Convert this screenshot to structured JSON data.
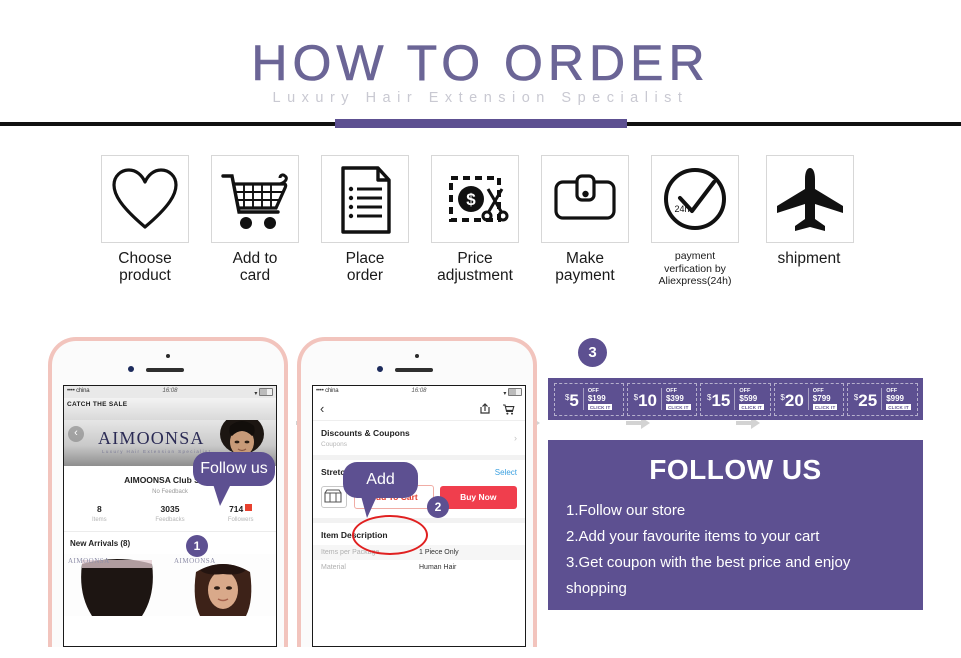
{
  "header": {
    "title": "HOW TO ORDER",
    "subtitle": "Luxury Hair Extension Specialist",
    "accent_color": "#5d5091"
  },
  "steps": [
    {
      "icon": "heart-icon",
      "label_line1": "Choose",
      "label_line2": "product"
    },
    {
      "icon": "shopping-cart-icon",
      "label_line1": "Add to",
      "label_line2": "card"
    },
    {
      "icon": "document-icon",
      "label_line1": "Place",
      "label_line2": "order"
    },
    {
      "icon": "price-scissors-icon",
      "label_line1": "Price",
      "label_line2": "adjustment"
    },
    {
      "icon": "wallet-icon",
      "label_line1": "Make",
      "label_line2": "payment"
    },
    {
      "icon": "clock-check-icon",
      "label_line1": "payment",
      "label_line2": "verfication by",
      "label_line3": "Aliexpress(24h)",
      "icon_text": "24h"
    },
    {
      "icon": "airplane-icon",
      "label_line1": "shipment",
      "label_line2": ""
    }
  ],
  "phone1": {
    "status": {
      "left": "•••• china",
      "center": "16:08",
      "wifi": "wifi-icon"
    },
    "sale_banner": "CATCH THE SALE",
    "logo": "AIMOONSA",
    "logo_sub": "Luxury Hair Extension Specialist",
    "store_name": "AIMOONSA Club Store",
    "feedback": "No Feedback",
    "stats": [
      {
        "value": "8",
        "label": "Items"
      },
      {
        "value": "3035",
        "label": "Feedbacks"
      },
      {
        "value": "714",
        "label": "Followers"
      }
    ],
    "new_arrivals": "New Arrivals (8)",
    "watermark": "AIMOONSA",
    "callout": "Follow us",
    "badge": "1"
  },
  "phone2": {
    "status": {
      "left": "•••• china",
      "center": "16:08"
    },
    "nav": {
      "back": "back-chevron-icon",
      "share": "share-icon",
      "cart": "cart-icon"
    },
    "discounts_title": "Discounts & Coupons",
    "discounts_sub": "Coupons",
    "stretched_title": "Stretched Length",
    "select_label": "Select",
    "add_to_cart": "Add To Cart",
    "buy_now": "Buy Now",
    "item_description": "Item Description",
    "attributes": [
      {
        "key": "Items per Package",
        "value": "1 Piece Only"
      },
      {
        "key": "Material",
        "value": "Human Hair"
      }
    ],
    "callout": "Add",
    "badge": "2"
  },
  "right": {
    "badge": "3",
    "coupons": [
      {
        "currency": "$",
        "amount": "5",
        "off": "OFF",
        "min": "$199",
        "click": "CLICK IT"
      },
      {
        "currency": "$",
        "amount": "10",
        "off": "OFF",
        "min": "$399",
        "click": "CLICK IT"
      },
      {
        "currency": "$",
        "amount": "15",
        "off": "OFF",
        "min": "$599",
        "click": "CLICK IT"
      },
      {
        "currency": "$",
        "amount": "20",
        "off": "OFF",
        "min": "$799",
        "click": "CLICK IT"
      },
      {
        "currency": "$",
        "amount": "25",
        "off": "OFF",
        "min": "$999",
        "click": "CLICK IT"
      }
    ],
    "follow_title": "FOLLOW US",
    "follow_steps": [
      "1.Follow our store",
      "2.Add your favourite items to your cart",
      "3.Get coupon with the best price and enjoy shopping"
    ]
  }
}
